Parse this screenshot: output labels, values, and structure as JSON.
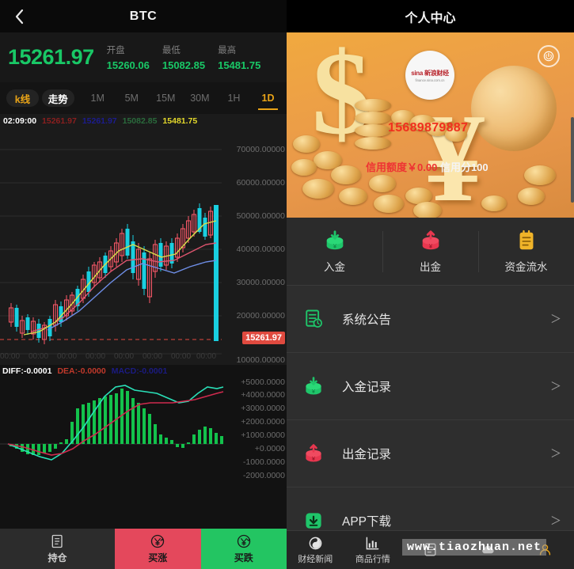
{
  "left": {
    "header": {
      "title": "BTC",
      "back_icon": "chevron-left-icon"
    },
    "quote": {
      "price": "15261.97",
      "stats": [
        {
          "label": "开盘",
          "value": "15260.06"
        },
        {
          "label": "最低",
          "value": "15082.85"
        },
        {
          "label": "最高",
          "value": "15481.75"
        }
      ]
    },
    "tabs": {
      "chart_types": [
        {
          "label": "k线",
          "active": true
        },
        {
          "label": "走势",
          "active": false
        }
      ],
      "periods": [
        {
          "label": "1M",
          "active": false
        },
        {
          "label": "5M",
          "active": false
        },
        {
          "label": "15M",
          "active": false
        },
        {
          "label": "30M",
          "active": false
        },
        {
          "label": "1H",
          "active": false
        },
        {
          "label": "1D",
          "active": true
        }
      ]
    },
    "infoline": {
      "time": "02:09:00",
      "open": "15261.97",
      "close": "15261.97",
      "low": "15082.85",
      "high": "15481.75"
    },
    "main_chart_y_labels": [
      "70000.00000",
      "60000.00000",
      "50000.00000",
      "40000.00000",
      "30000.00000",
      "20000.00000",
      "10000.00000"
    ],
    "current_price_tag": "15261.97",
    "x_labels": [
      "00:00",
      "00:00",
      "00:00",
      "00:00",
      "00:00",
      "00:00",
      "00:00",
      "00:00"
    ],
    "macd": {
      "diff_label": "DIFF:-0.0001",
      "dea_label": "DEA:-0.0000",
      "macd_label": "MACD:-0.0001",
      "y_labels": [
        "+5000.0000",
        "+4000.0000",
        "+3000.0000",
        "+2000.0000",
        "+1000.0000",
        "+0.0000",
        "-1000.0000",
        "-2000.0000"
      ]
    },
    "bottom_bar": [
      {
        "label": "持仓",
        "icon": "position-document-icon",
        "style": "dark"
      },
      {
        "label": "买涨",
        "icon": "yen-up-icon",
        "style": "red"
      },
      {
        "label": "买跌",
        "icon": "yen-down-icon",
        "style": "green"
      }
    ]
  },
  "right": {
    "header": {
      "title": "个人中心"
    },
    "banner": {
      "phone": "15689879887",
      "credit_text_red": "信用额度￥0.00",
      "credit_text_white": "信用分100",
      "logo_main": "sina 新浪财经",
      "logo_sub": "finance.sina.com.cn",
      "power_icon": "power-icon"
    },
    "actions": [
      {
        "label": "入金",
        "icon": "deposit-icon",
        "color": "#1fc56a"
      },
      {
        "label": "出金",
        "icon": "withdraw-icon",
        "color": "#e8374f"
      },
      {
        "label": "资金流水",
        "icon": "fund-flow-icon",
        "color": "#f0b429"
      }
    ],
    "menu": [
      {
        "label": "系统公告",
        "icon": "announcement-icon",
        "color": "#1fc56a",
        "arrow": "＞"
      },
      {
        "label": "入金记录",
        "icon": "deposit-record-icon",
        "color": "#1fc56a",
        "arrow": "＞"
      },
      {
        "label": "出金记录",
        "icon": "withdraw-record-icon",
        "color": "#e8374f",
        "arrow": "＞"
      },
      {
        "label": "APP下载",
        "icon": "app-download-icon",
        "color": "#1fc56a",
        "arrow": "＞"
      }
    ],
    "bottom_nav": [
      {
        "label": "财经新闻",
        "icon": "news-icon",
        "active": false
      },
      {
        "label": "商品行情",
        "icon": "market-chart-icon",
        "active": false
      },
      {
        "label": "",
        "icon": "order-icon",
        "active": false
      },
      {
        "label": "",
        "icon": "cloud-icon",
        "active": false
      },
      {
        "label": "",
        "icon": "user-icon",
        "active": true
      }
    ],
    "watermark": "www.tiaozhuan.net"
  },
  "colors": {
    "up": "#19c866",
    "down": "#e04a3f",
    "accent": "#e8a317",
    "banner": "#eda046"
  }
}
